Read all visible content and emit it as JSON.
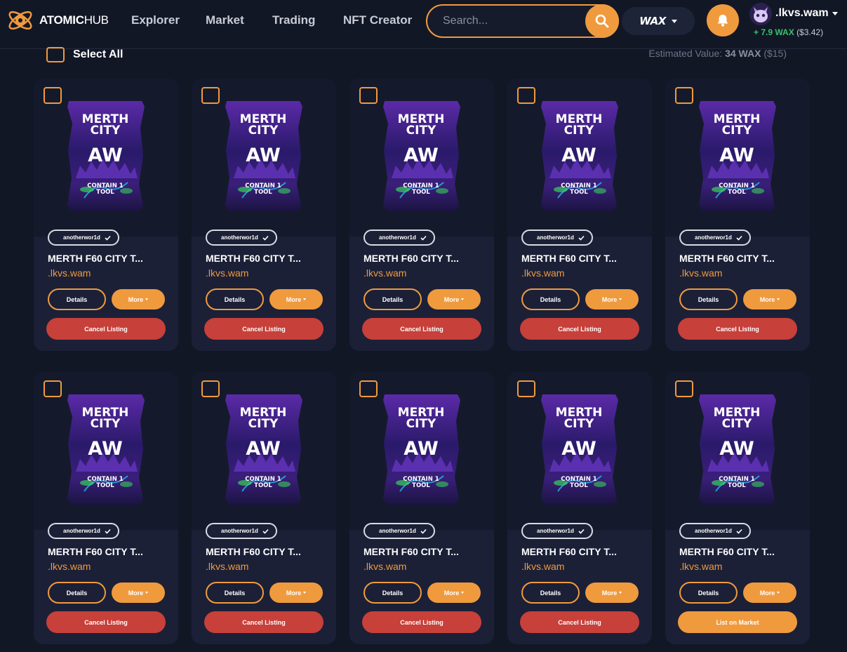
{
  "brand": {
    "name_bold": "ATOMIC",
    "name_light": "HUB"
  },
  "nav": {
    "links": [
      "Explorer",
      "Market",
      "Trading",
      "NFT Creator"
    ]
  },
  "search": {
    "placeholder": "Search...",
    "icon": "search-icon"
  },
  "network": {
    "label": "WAX"
  },
  "user": {
    "name": ".lkvs.wam",
    "balance_prefix": "+",
    "balance_wax": "7.9 WAX",
    "balance_usd": "($3.42)"
  },
  "toolbar": {
    "select_all": "Select All",
    "estimated_label": "Estimated Value:",
    "estimated_wax": "34 WAX",
    "estimated_usd": "($15)"
  },
  "pack_art": {
    "line1": "MERTH",
    "line2": "CITY",
    "logo": "AW",
    "line3": "CONTAIN 1",
    "line4": "TOOL"
  },
  "cards": [
    {
      "collection": "anotherwor1d",
      "title": "MERTH F60 CITY T...",
      "owner": ".lkvs.wam",
      "details": "Details",
      "more": "More",
      "action": "Cancel Listing"
    },
    {
      "collection": "anotherwor1d",
      "title": "MERTH F60 CITY T...",
      "owner": ".lkvs.wam",
      "details": "Details",
      "more": "More",
      "action": "Cancel Listing"
    },
    {
      "collection": "anotherwor1d",
      "title": "MERTH F60 CITY T...",
      "owner": ".lkvs.wam",
      "details": "Details",
      "more": "More",
      "action": "Cancel Listing"
    },
    {
      "collection": "anotherwor1d",
      "title": "MERTH F60 CITY T...",
      "owner": ".lkvs.wam",
      "details": "Details",
      "more": "More",
      "action": "Cancel Listing"
    },
    {
      "collection": "anotherwor1d",
      "title": "MERTH F60 CITY T...",
      "owner": ".lkvs.wam",
      "details": "Details",
      "more": "More",
      "action": "Cancel Listing"
    },
    {
      "collection": "anotherwor1d",
      "title": "MERTH F60 CITY T...",
      "owner": ".lkvs.wam",
      "details": "Details",
      "more": "More",
      "action": "Cancel Listing"
    },
    {
      "collection": "anotherwor1d",
      "title": "MERTH F60 CITY T...",
      "owner": ".lkvs.wam",
      "details": "Details",
      "more": "More",
      "action": "Cancel Listing"
    },
    {
      "collection": "anotherwor1d",
      "title": "MERTH F60 CITY T...",
      "owner": ".lkvs.wam",
      "details": "Details",
      "more": "More",
      "action": "Cancel Listing"
    },
    {
      "collection": "anotherwor1d",
      "title": "MERTH F60 CITY T...",
      "owner": ".lkvs.wam",
      "details": "Details",
      "more": "More",
      "action": "Cancel Listing"
    },
    {
      "collection": "anotherwor1d",
      "title": "MERTH F60 CITY T...",
      "owner": ".lkvs.wam",
      "details": "Details",
      "more": "More",
      "action": "List on Market"
    }
  ],
  "colors": {
    "accent": "#f09a3e",
    "danger": "#c7403a",
    "positive": "#36c46b",
    "card_bg": "#1b2037",
    "page_bg": "#121726"
  }
}
